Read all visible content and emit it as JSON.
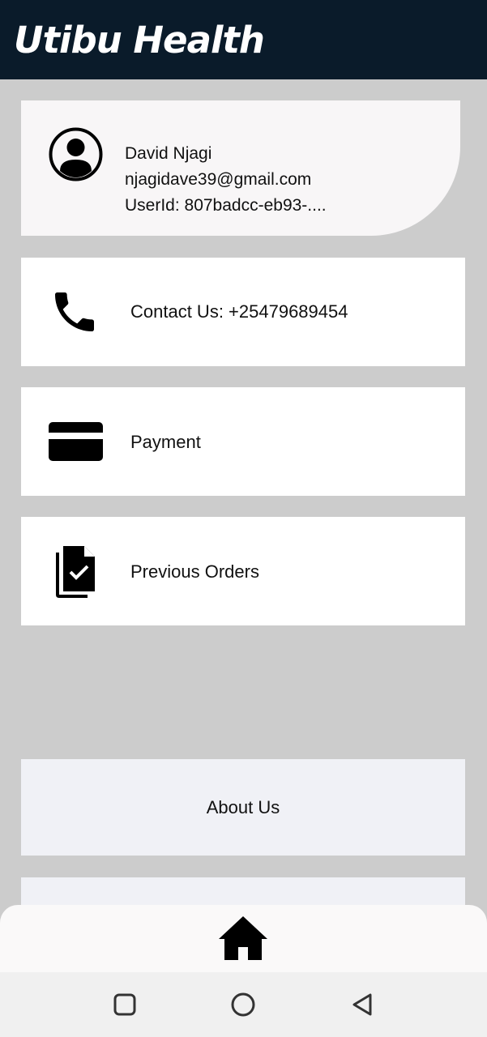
{
  "app": {
    "title": "Utibu Health"
  },
  "profile": {
    "name": "David Njagi",
    "email": "njagidave39@gmail.com",
    "user_id": "UserId: 807badcc-eb93-...."
  },
  "menu": {
    "contact": "Contact Us: +25479689454",
    "payment": "Payment",
    "orders": "Previous Orders",
    "about": "About Us"
  },
  "icons": {
    "avatar": "account-circle-icon",
    "contact": "phone-icon",
    "payment": "credit-card-icon",
    "orders": "documents-check-icon",
    "home": "home-icon",
    "recent": "square-recents-icon",
    "home_sys": "circle-home-icon",
    "back": "triangle-back-icon"
  },
  "colors": {
    "appbar": "#0a1b2a",
    "background": "#cccccc",
    "card": "#ffffff",
    "profile_card": "#f8f6f7",
    "plain_card": "#f0f1f6"
  }
}
